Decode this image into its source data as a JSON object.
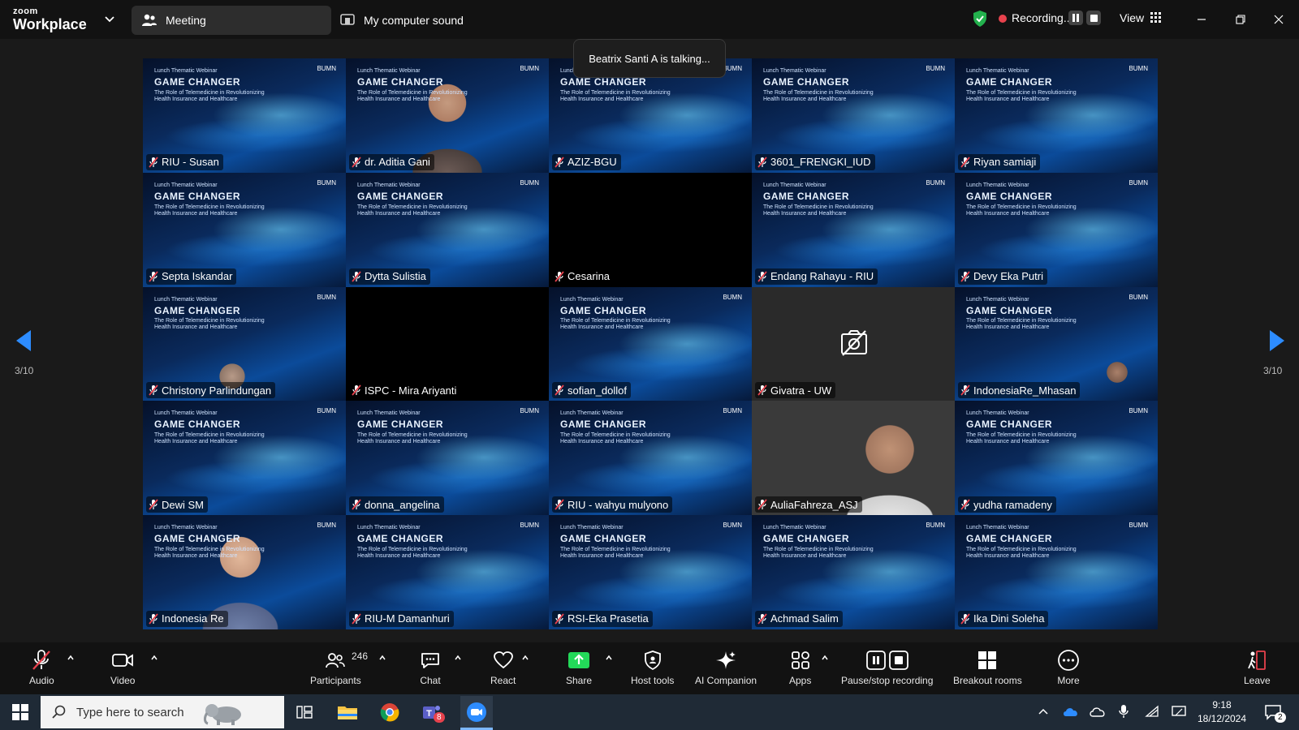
{
  "app": {
    "brand_top": "zoom",
    "brand_bottom": "Workplace"
  },
  "topbar": {
    "meeting_tab": "Meeting",
    "sound_tab": "My computer sound",
    "recording": "Recording...",
    "view": "View"
  },
  "talking_banner": "Beatrix Santi A is talking...",
  "slide": {
    "small": "Lunch Thematic Webinar",
    "title": "GAME CHANGER",
    "subtitle1": "The Role of Telemedicine in Revolutionizing",
    "subtitle2": "Health Insurance and Healthcare",
    "logo": "BUMN"
  },
  "tiles": [
    {
      "name": "RIU - Susan",
      "kind": "slide"
    },
    {
      "name": "dr. Aditia Gani",
      "kind": "person1"
    },
    {
      "name": "AZIZ-BGU",
      "kind": "slide"
    },
    {
      "name": "3601_FRENGKI_IUD",
      "kind": "slide"
    },
    {
      "name": "Riyan samiaji",
      "kind": "slide"
    },
    {
      "name": "Septa Iskandar",
      "kind": "slide"
    },
    {
      "name": "Dytta Sulistia",
      "kind": "slide"
    },
    {
      "name": "Cesarina",
      "kind": "black"
    },
    {
      "name": "Endang Rahayu - RIU",
      "kind": "slide"
    },
    {
      "name": "Devy Eka Putri",
      "kind": "slide"
    },
    {
      "name": "Christony Parlindungan",
      "kind": "person2"
    },
    {
      "name": "ISPC - Mira Ariyanti",
      "kind": "black"
    },
    {
      "name": "sofian_dollof",
      "kind": "slide"
    },
    {
      "name": "Givatra - UW",
      "kind": "gray"
    },
    {
      "name": "IndonesiaRe_Mhasan",
      "kind": "person3"
    },
    {
      "name": "Dewi SM",
      "kind": "slide"
    },
    {
      "name": "donna_angelina",
      "kind": "slide"
    },
    {
      "name": "RIU - wahyu mulyono",
      "kind": "slide"
    },
    {
      "name": "AuliaFahreza_ASJ",
      "kind": "person4"
    },
    {
      "name": "yudha ramadeny",
      "kind": "slide"
    },
    {
      "name": "Indonesia Re",
      "kind": "person5"
    },
    {
      "name": "RIU-M Damanhuri",
      "kind": "slide"
    },
    {
      "name": "RSI-Eka Prasetia",
      "kind": "slide"
    },
    {
      "name": "Achmad Salim",
      "kind": "slide"
    },
    {
      "name": "Ika Dini Soleha",
      "kind": "slide"
    }
  ],
  "pagination": {
    "left": "3/10",
    "right": "3/10"
  },
  "toolbar": {
    "audio": "Audio",
    "video": "Video",
    "participants": "Participants",
    "participant_count": "246",
    "chat": "Chat",
    "react": "React",
    "share": "Share",
    "host_tools": "Host tools",
    "ai_companion": "AI Companion",
    "apps": "Apps",
    "pause_stop": "Pause/stop recording",
    "breakout": "Breakout rooms",
    "more": "More",
    "leave": "Leave"
  },
  "taskbar": {
    "search_placeholder": "Type here to search",
    "teams_badge": "8",
    "time": "9:18",
    "date": "18/12/2024",
    "notif_count": "2"
  },
  "colors": {
    "accent_blue": "#2d8cff",
    "share_green": "#23d959",
    "rec_red": "#e8424d",
    "leave_red": "#e8424d"
  }
}
